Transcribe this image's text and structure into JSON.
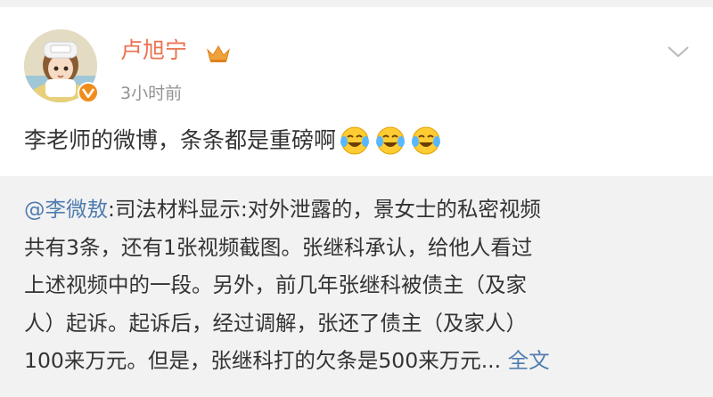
{
  "post": {
    "author": {
      "name": "卢旭宁",
      "avatar_icon": "anime-avatar-icon",
      "verified_badge_icon": "verified-v-icon",
      "member_icon": "crown-icon"
    },
    "timestamp": "3小时前",
    "menu_icon": "chevron-down-icon",
    "text": "李老师的微博，条条都是重磅啊",
    "emojis": [
      "laugh-cry-emoji",
      "laugh-cry-emoji",
      "laugh-cry-emoji"
    ]
  },
  "repost": {
    "mention": "@李微敖",
    "lines": [
      ":司法材料显示:对外泄露的，景女士的私密视频",
      "共有3条，还有1张视频截图。张继科承认，给他人看过",
      "上述视频中的一段。另外，前几年张继科被债主（及家",
      "人）起诉。起诉后，经过调解，张还了债主（及家人）",
      "100来万元。但是，张继科打的欠条是500来万元... "
    ],
    "full_text_link": "全文"
  },
  "colors": {
    "username": "#eb7350",
    "link": "#507daf",
    "text": "#333333",
    "meta": "#939393",
    "repost_bg": "#f2f2f2",
    "badge": "#f08c1a"
  }
}
